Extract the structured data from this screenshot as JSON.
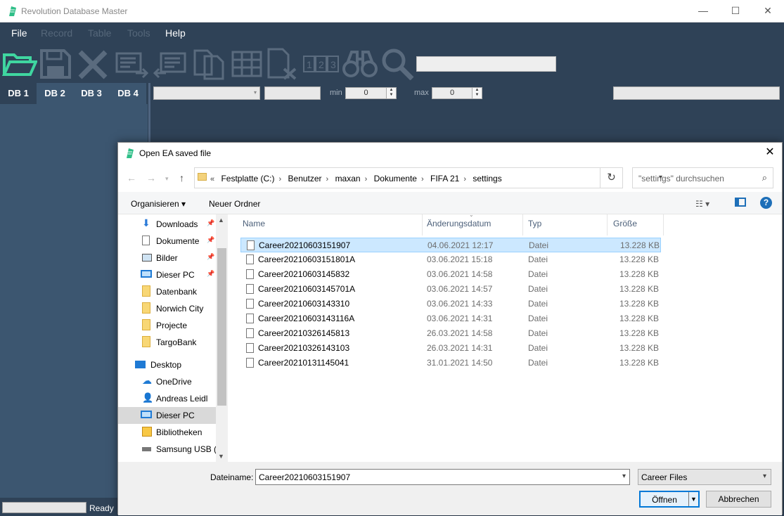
{
  "app": {
    "title": "Revolution Database Master",
    "menu": [
      "File",
      "Record",
      "Table",
      "Tools",
      "Help"
    ],
    "db_tabs": [
      "DB 1",
      "DB 2",
      "DB 3",
      "DB 4"
    ],
    "filter": {
      "min_label": "min",
      "min_value": "0",
      "max_label": "max",
      "max_value": "0"
    },
    "status": "Ready",
    "window_controls": {
      "minimize": "—",
      "maximize": "☐",
      "close": "✕"
    }
  },
  "dialog": {
    "title": "Open EA saved file",
    "close": "✕",
    "breadcrumb": [
      "Festplatte (C:)",
      "Benutzer",
      "maxan",
      "Dokumente",
      "FIFA 21",
      "settings"
    ],
    "breadcrumb_prefix": "«",
    "search_placeholder": "\"settings\" durchsuchen",
    "commands": {
      "organize": "Organisieren ▾",
      "new_folder": "Neuer Ordner",
      "help": "?"
    },
    "nav": [
      {
        "label": "Downloads",
        "icon": "download-icon",
        "pinned": true
      },
      {
        "label": "Dokumente",
        "icon": "document-icon",
        "pinned": true
      },
      {
        "label": "Bilder",
        "icon": "picture-icon",
        "pinned": true
      },
      {
        "label": "Dieser PC",
        "icon": "monitor-icon",
        "pinned": true
      },
      {
        "label": "Datenbank",
        "icon": "folder-icon",
        "pinned": false
      },
      {
        "label": "Norwich City",
        "icon": "folder-icon",
        "pinned": false
      },
      {
        "label": "Projecte",
        "icon": "folder-icon",
        "pinned": false
      },
      {
        "label": "TargoBank",
        "icon": "folder-icon",
        "pinned": false
      },
      {
        "label": "Desktop",
        "icon": "desktop-icon",
        "pinned": false
      },
      {
        "label": "OneDrive",
        "icon": "cloud-icon",
        "pinned": false
      },
      {
        "label": "Andreas Leidl",
        "icon": "user-icon",
        "pinned": false
      },
      {
        "label": "Dieser PC",
        "icon": "monitor-icon",
        "pinned": false
      },
      {
        "label": "Bibliotheken",
        "icon": "library-icon",
        "pinned": false
      },
      {
        "label": "Samsung USB (G",
        "icon": "usb-drive-icon",
        "pinned": false
      }
    ],
    "columns": [
      "Name",
      "Änderungsdatum",
      "Typ",
      "Größe"
    ],
    "files": [
      {
        "name": "Career20210603151907",
        "date": "04.06.2021 12:17",
        "type": "Datei",
        "size": "13.228 KB"
      },
      {
        "name": "Career20210603151801A",
        "date": "03.06.2021 15:18",
        "type": "Datei",
        "size": "13.228 KB"
      },
      {
        "name": "Career20210603145832",
        "date": "03.06.2021 14:58",
        "type": "Datei",
        "size": "13.228 KB"
      },
      {
        "name": "Career20210603145701A",
        "date": "03.06.2021 14:57",
        "type": "Datei",
        "size": "13.228 KB"
      },
      {
        "name": "Career20210603143310",
        "date": "03.06.2021 14:33",
        "type": "Datei",
        "size": "13.228 KB"
      },
      {
        "name": "Career20210603143116A",
        "date": "03.06.2021 14:31",
        "type": "Datei",
        "size": "13.228 KB"
      },
      {
        "name": "Career20210326145813",
        "date": "26.03.2021 14:58",
        "type": "Datei",
        "size": "13.228 KB"
      },
      {
        "name": "Career20210326143103",
        "date": "26.03.2021 14:31",
        "type": "Datei",
        "size": "13.228 KB"
      },
      {
        "name": "Career20210131145041",
        "date": "31.01.2021 14:50",
        "type": "Datei",
        "size": "13.228 KB"
      }
    ],
    "filename_label": "Dateiname:",
    "filename_value": "Career20210603151907",
    "filetype": "Career Files",
    "open_label": "Öffnen",
    "cancel_label": "Abbrechen"
  },
  "colors": {
    "app_bg": "#2f4257",
    "panel": "#3c5670",
    "accent": "#0078d7",
    "selection": "#cce8ff",
    "open_icon": "#3fd6a0"
  }
}
